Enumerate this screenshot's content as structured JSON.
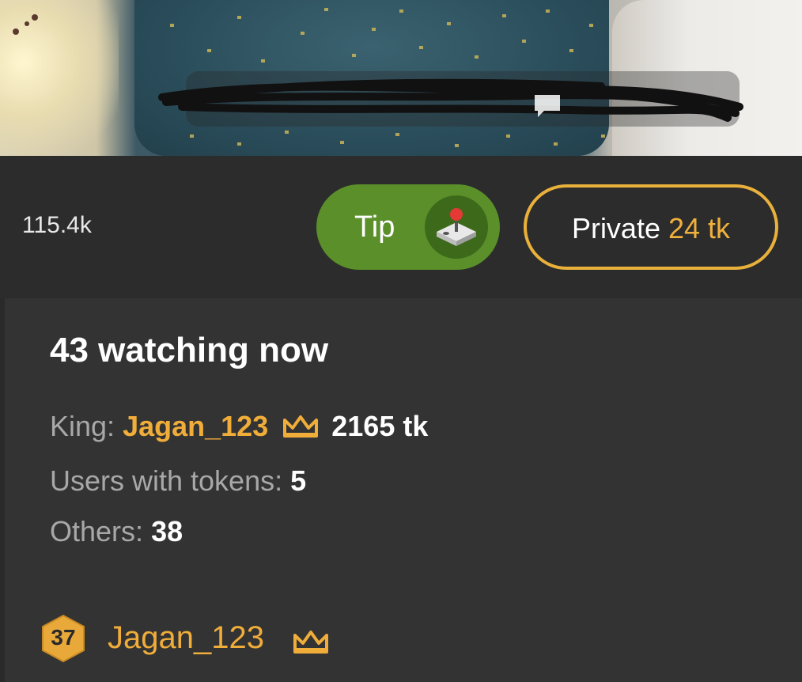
{
  "stream": {
    "viewer_count": "115.4k",
    "tip_button": {
      "label": "Tip",
      "icon": "joystick-icon"
    },
    "private_button": {
      "label": "Private",
      "price": "24 tk"
    }
  },
  "viewers": {
    "title": "43 watching now",
    "king": {
      "label": "King:",
      "name": "Jagan_123",
      "amount": "2165 tk",
      "icon": "crown-icon"
    },
    "users_with_tokens": {
      "label": "Users with tokens:",
      "value": "5"
    },
    "others": {
      "label": "Others:",
      "value": "38"
    }
  },
  "user_list": [
    {
      "level": "37",
      "name": "Jagan_123",
      "icon": "crown-icon"
    }
  ],
  "colors": {
    "tip_green": "#5a8f2a",
    "accent_gold": "#f0ad3a",
    "background": "#333333"
  }
}
